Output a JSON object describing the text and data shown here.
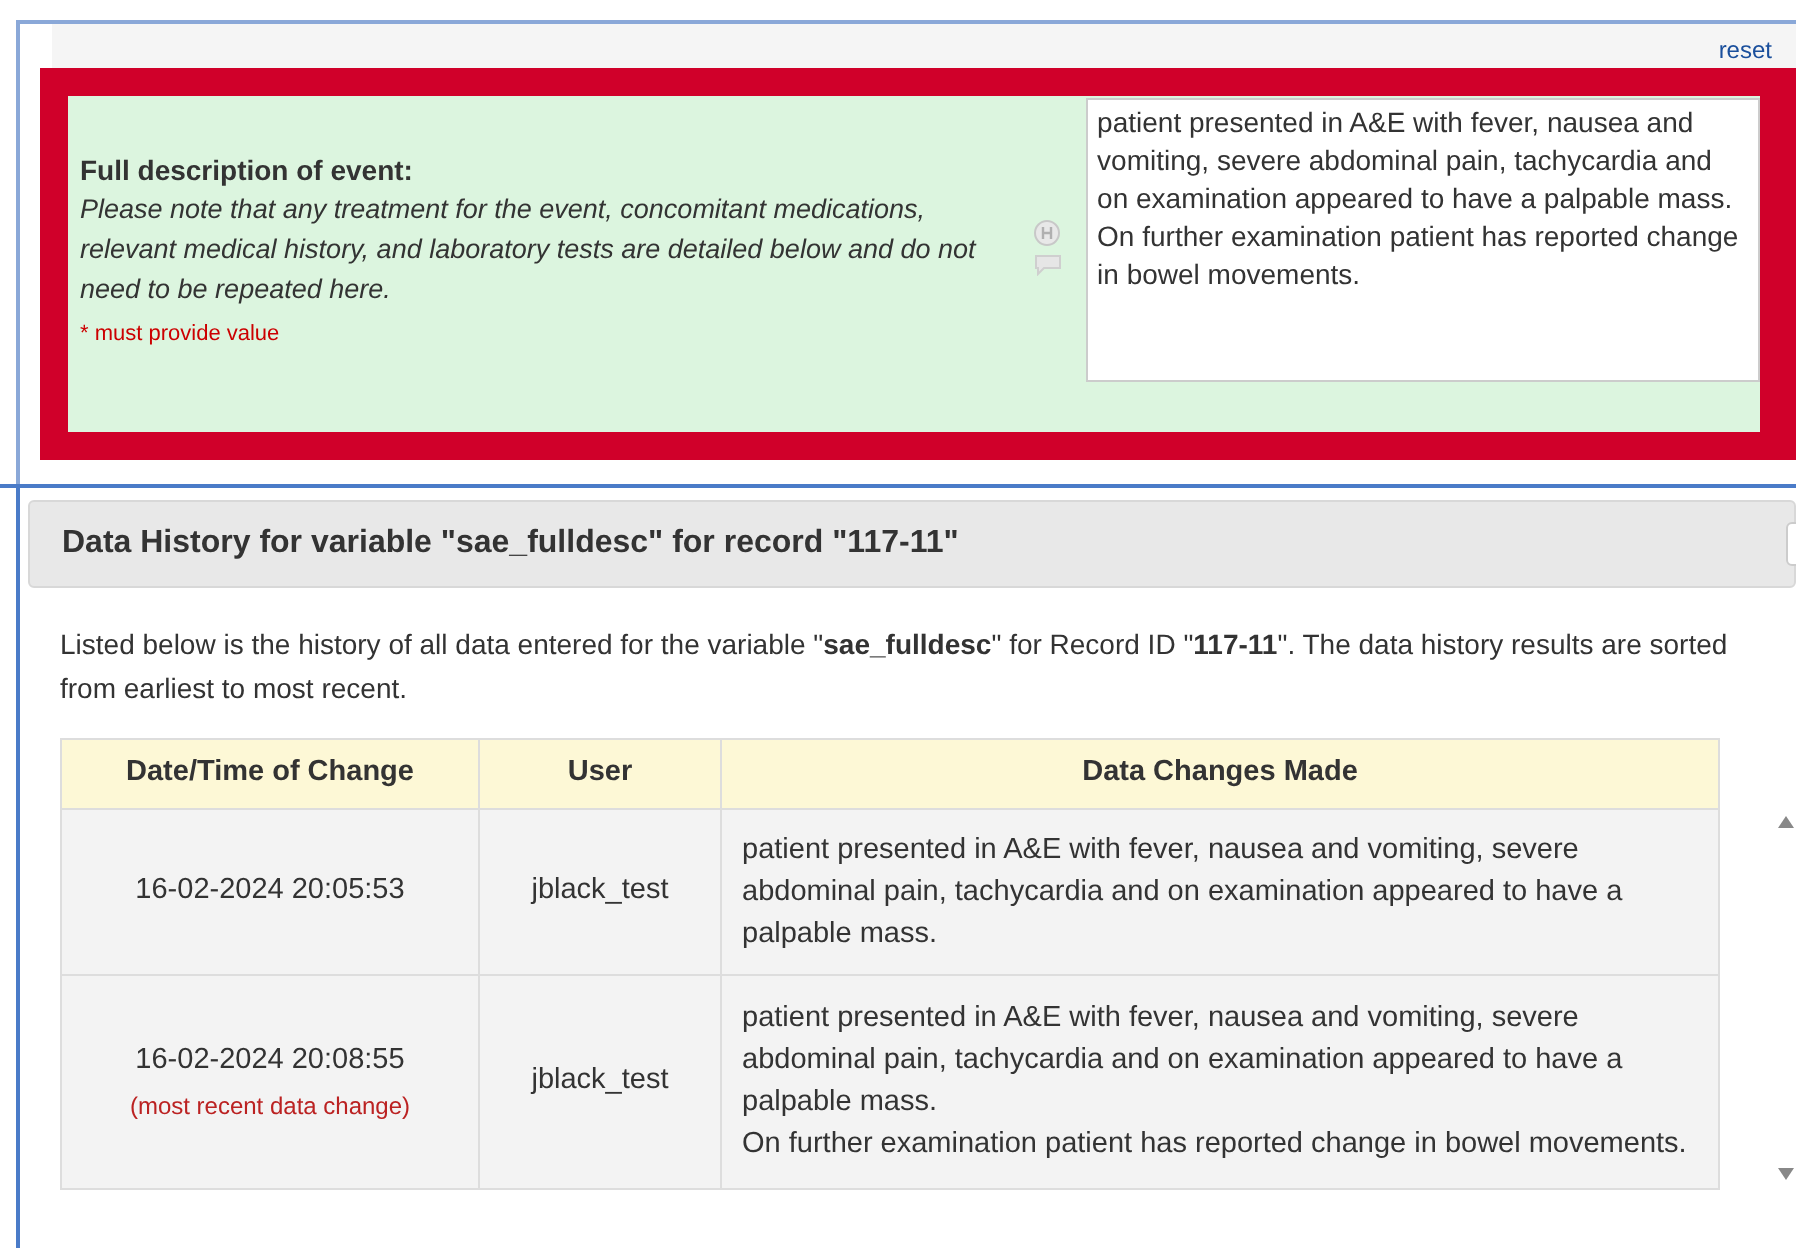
{
  "form": {
    "reset_link": "reset",
    "field": {
      "label": "Full description of event:",
      "note": "Please note that any treatment for the event, concomitant medications, relevant medical history, and laboratory tests are detailed below and do not need to be repeated here.",
      "required_text": "* must provide value",
      "highlighted": true,
      "value": "patient presented in A&E with fever, nausea and vomiting, severe abdominal pain, tachycardia and on examination appeared to have a palpable mass.\nOn further examination patient has reported change in bowel movements."
    }
  },
  "dialog": {
    "title": "Data History for variable \"sae_fulldesc\" for record \"117-11\"",
    "intro": "Listed below is the history of all data entered for the variable \"**sae_fulldesc**\" for Record ID \"**117-11**\". The data history results are sorted from earliest to most recent.",
    "table": {
      "columns": [
        "Date/Time of Change",
        "User",
        "Data Changes Made"
      ],
      "rows": [
        {
          "datetime": "16-02-2024 20:05:53",
          "user": "jblack_test",
          "change": "patient presented in A&E with fever, nausea and vomiting, severe abdominal pain, tachycardia and on examination appeared to have a palpable mass."
        },
        {
          "datetime": "16-02-2024 20:08:55",
          "note": "(most recent data change)",
          "user": "jblack_test",
          "change": "patient presented in A&E with fever, nausea and vomiting, severe abdominal pain, tachycardia and on examination appeared to have a palpable mass.\nOn further examination patient has reported change in bowel movements."
        }
      ]
    }
  }
}
